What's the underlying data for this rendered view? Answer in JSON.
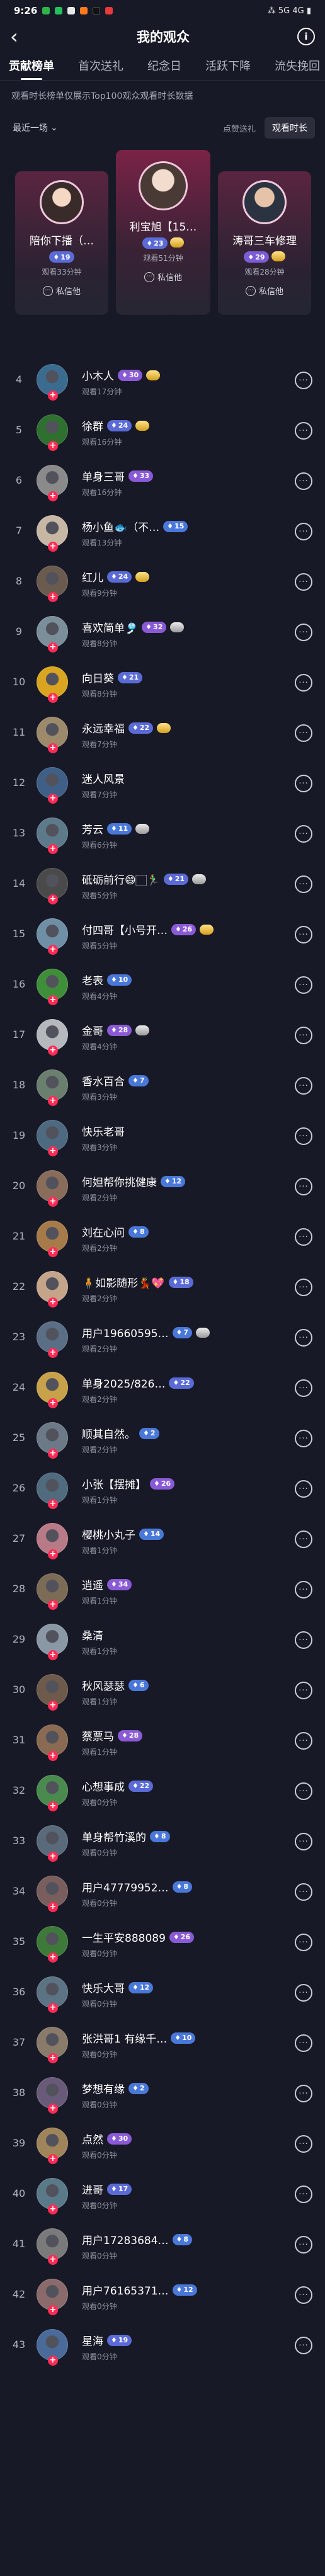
{
  "status_bar": {
    "time": "9:26",
    "right": "⁂ 5G 4G ▮"
  },
  "header": {
    "title": "我的观众"
  },
  "tabs": [
    "贡献榜单",
    "首次送礼",
    "纪念日",
    "活跃下降",
    "流失挽回"
  ],
  "notice": "观看时长榜单仅展示Top100观众观看时长数据",
  "filters": {
    "period": "最近一场",
    "like_gift": "点赞送礼",
    "watch_duration": "观看时长"
  },
  "podium": [
    {
      "rank": 2,
      "name": "陪你下播（…",
      "level": "19",
      "level_color": "#5b6bd6",
      "time": "观看33分钟",
      "message": "私信他"
    },
    {
      "rank": 1,
      "name": "利宝旭【15…",
      "level": "23",
      "level_color": "#5b6bd6",
      "time": "观看51分钟",
      "message": "私信他"
    },
    {
      "rank": 3,
      "name": "涛哥三车修理",
      "level": "29",
      "level_color": "#7b5cd6",
      "time": "观看28分钟",
      "message": "私信他"
    }
  ],
  "viewers": [
    {
      "rank": "4",
      "name": "小木人",
      "level": "30",
      "extra": "gold",
      "time": "观看17分钟",
      "avatar": "#3b6b8f"
    },
    {
      "rank": "5",
      "name": "徐群",
      "level": "24",
      "extra": "gold",
      "time": "观看16分钟",
      "avatar": "#2f6f2f"
    },
    {
      "rank": "6",
      "name": "单身三哥",
      "level": "33",
      "extra": "",
      "time": "观看16分钟",
      "avatar": "#8a8a8a"
    },
    {
      "rank": "7",
      "name": "杨小鱼🐟（不…",
      "level": "15",
      "extra": "",
      "time": "观看13分钟",
      "avatar": "#c7b7a5"
    },
    {
      "rank": "8",
      "name": "红儿",
      "level": "24",
      "extra": "gold",
      "time": "观看9分钟",
      "avatar": "#6b5a4e"
    },
    {
      "rank": "9",
      "name": "喜欢简单🎐",
      "level": "32",
      "extra": "gray",
      "time": "观看8分钟",
      "avatar": "#7a8f9a"
    },
    {
      "rank": "10",
      "name": "向日葵",
      "level": "21",
      "extra": "",
      "time": "观看8分钟",
      "avatar": "#d9a520"
    },
    {
      "rank": "11",
      "name": "永远幸福",
      "level": "22",
      "extra": "gold",
      "time": "观看7分钟",
      "avatar": "#9c8a6b"
    },
    {
      "rank": "12",
      "name": "迷人风景",
      "level": "",
      "extra": "",
      "time": "观看7分钟",
      "avatar": "#3f5f86"
    },
    {
      "rank": "13",
      "name": "芳云",
      "level": "11",
      "extra": "gray",
      "time": "观看6分钟",
      "avatar": "#5d7a8a"
    },
    {
      "rank": "14",
      "name": "砥砺前行😄🏻🏃‍♂️",
      "level": "21",
      "extra": "gray",
      "time": "观看5分钟",
      "avatar": "#4a4a4a"
    },
    {
      "rank": "15",
      "name": "付四哥【小号开…",
      "level": "26",
      "extra": "gold",
      "time": "观看5分钟",
      "avatar": "#6e8fa6"
    },
    {
      "rank": "16",
      "name": "老表",
      "level": "10",
      "extra": "",
      "time": "观看4分钟",
      "avatar": "#3f8f3a"
    },
    {
      "rank": "17",
      "name": "金哥",
      "level": "28",
      "extra": "gray",
      "time": "观看4分钟",
      "avatar": "#b5b8bd"
    },
    {
      "rank": "18",
      "name": "香水百合",
      "level": "7",
      "extra": "",
      "time": "观看3分钟",
      "avatar": "#6b7f6e"
    },
    {
      "rank": "19",
      "name": "快乐老哥",
      "level": "",
      "extra": "",
      "time": "观看3分钟",
      "avatar": "#4d6a80"
    },
    {
      "rank": "20",
      "name": "何妲帮你挑健康",
      "level": "12",
      "extra": "",
      "time": "观看2分钟",
      "avatar": "#8a6c5a"
    },
    {
      "rank": "21",
      "name": "刘在心问",
      "level": "8",
      "extra": "",
      "time": "观看2分钟",
      "avatar": "#a77a4a"
    },
    {
      "rank": "22",
      "name": "🧍如影随形💃💖",
      "level": "18",
      "extra": "",
      "time": "观看2分钟",
      "avatar": "#c5a58a"
    },
    {
      "rank": "23",
      "name": "用户19660595…",
      "level": "7",
      "extra": "gray",
      "time": "观看2分钟",
      "avatar": "#5a6e86"
    },
    {
      "rank": "24",
      "name": "单身2025/826…",
      "level": "22",
      "extra": "",
      "time": "观看2分钟",
      "avatar": "#c8a24a"
    },
    {
      "rank": "25",
      "name": "顺其自然。",
      "level": "2",
      "extra": "",
      "time": "观看2分钟",
      "avatar": "#6c7a88"
    },
    {
      "rank": "26",
      "name": "小张【摆摊】",
      "level": "26",
      "extra": "",
      "time": "观看1分钟",
      "avatar": "#4f6b7d"
    },
    {
      "rank": "27",
      "name": "樱桃小丸子",
      "level": "14",
      "extra": "",
      "time": "观看1分钟",
      "avatar": "#b87a86"
    },
    {
      "rank": "28",
      "name": "逍遥",
      "level": "34",
      "extra": "",
      "time": "观看1分钟",
      "avatar": "#7c6b55"
    },
    {
      "rank": "29",
      "name": "桑清",
      "level": "",
      "extra": "",
      "time": "观看1分钟",
      "avatar": "#8a98a6"
    },
    {
      "rank": "30",
      "name": "秋风瑟瑟",
      "level": "6",
      "extra": "",
      "time": "观看1分钟",
      "avatar": "#6e5a4a"
    },
    {
      "rank": "31",
      "name": "蔡票马",
      "level": "28",
      "extra": "",
      "time": "观看1分钟",
      "avatar": "#8a6a52"
    },
    {
      "rank": "32",
      "name": "心想事成",
      "level": "22",
      "extra": "",
      "time": "观看0分钟",
      "avatar": "#4a8a4e"
    },
    {
      "rank": "33",
      "name": "单身帮竹溪的",
      "level": "8",
      "extra": "",
      "time": "观看0分钟",
      "avatar": "#596a7a"
    },
    {
      "rank": "34",
      "name": "用户47779952…",
      "level": "8",
      "extra": "",
      "time": "观看0分钟",
      "avatar": "#7a5e5e"
    },
    {
      "rank": "35",
      "name": "一生平安888089",
      "level": "26",
      "extra": "",
      "time": "观看0分钟",
      "avatar": "#3d7a3a"
    },
    {
      "rank": "36",
      "name": "快乐大哥",
      "level": "12",
      "extra": "",
      "time": "观看0分钟",
      "avatar": "#5c7384"
    },
    {
      "rank": "37",
      "name": "张洪哥1 有缘千…",
      "level": "10",
      "extra": "",
      "time": "观看0分钟",
      "avatar": "#8a7a6a"
    },
    {
      "rank": "38",
      "name": "梦想有缘",
      "level": "2",
      "extra": "",
      "time": "观看0分钟",
      "avatar": "#6a5a7a"
    },
    {
      "rank": "39",
      "name": "点然",
      "level": "30",
      "extra": "",
      "time": "观看0分钟",
      "avatar": "#a0845a"
    },
    {
      "rank": "40",
      "name": "进哥",
      "level": "17",
      "extra": "",
      "time": "观看0分钟",
      "avatar": "#5a7a8a"
    },
    {
      "rank": "41",
      "name": "用户17283684…",
      "level": "8",
      "extra": "",
      "time": "观看0分钟",
      "avatar": "#7a7a7a"
    },
    {
      "rank": "42",
      "name": "用户76165371…",
      "level": "12",
      "extra": "",
      "time": "观看0分钟",
      "avatar": "#8a6a6a"
    },
    {
      "rank": "43",
      "name": "星海",
      "level": "19",
      "extra": "",
      "time": "观看0分钟",
      "avatar": "#4a6a9a"
    }
  ]
}
